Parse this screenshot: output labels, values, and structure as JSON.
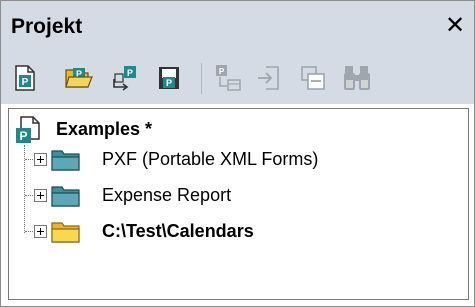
{
  "panel": {
    "title": "Projekt",
    "close_glyph": "✕"
  },
  "toolbar": {
    "buttons": [
      {
        "icon": "new-project-icon",
        "enabled": true
      },
      {
        "icon": "open-project-icon",
        "enabled": true
      },
      {
        "icon": "reload-project-icon",
        "enabled": true
      },
      {
        "icon": "save-project-icon",
        "enabled": true
      },
      {
        "icon": "add-to-project-icon",
        "enabled": false
      },
      {
        "icon": "add-external-file-icon",
        "enabled": false
      },
      {
        "icon": "add-folder-icon",
        "enabled": false
      },
      {
        "icon": "find-in-project-icon",
        "enabled": false
      }
    ]
  },
  "tree": {
    "root": {
      "label": "Examples *",
      "icon": "project-icon"
    },
    "items": [
      {
        "label": "PXF (Portable XML Forms)",
        "icon": "folder-teal-icon",
        "bold": false,
        "expanded": false
      },
      {
        "label": "Expense Report",
        "icon": "folder-teal-icon",
        "bold": false,
        "expanded": false
      },
      {
        "label": "C:\\Test\\Calendars",
        "icon": "folder-yellow-icon",
        "bold": true,
        "expanded": false
      }
    ]
  },
  "colors": {
    "header_bg": "#d5dbe4",
    "icon_teal": "#1b8c8c",
    "folder_teal": "#3f8f9f",
    "folder_yellow": "#f2cd3a",
    "icon_disabled": "#a0a6ad"
  }
}
